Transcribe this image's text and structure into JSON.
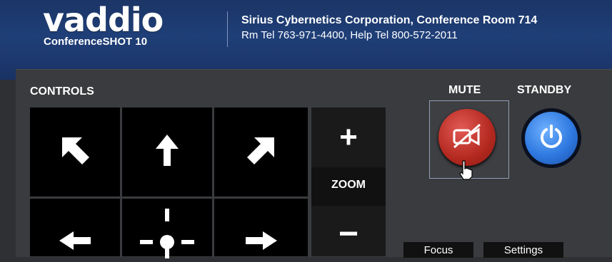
{
  "header": {
    "brand": "vaddio",
    "model": "ConferenceSHOT 10",
    "room": "Sirius Cybernetics Corporation, Conference Room 714",
    "phones": "Rm Tel 763-971-4400, Help Tel 800-572-2011"
  },
  "controls": {
    "title": "CONTROLS",
    "pad": {
      "up_left": "arrow-up-left-icon",
      "up": "arrow-up-icon",
      "up_right": "arrow-up-right-icon",
      "left": "arrow-left-icon",
      "home": "home-crosshair-icon",
      "right": "arrow-right-icon"
    },
    "zoom": {
      "label": "ZOOM",
      "in": "+",
      "out": "−"
    }
  },
  "mute": {
    "label": "MUTE",
    "icon": "video-muted-icon",
    "color": "#c0392b"
  },
  "standby": {
    "label": "STANDBY",
    "icon": "power-icon",
    "color": "#2d6fd6"
  },
  "tabs": {
    "focus": "Focus",
    "settings": "Settings"
  }
}
